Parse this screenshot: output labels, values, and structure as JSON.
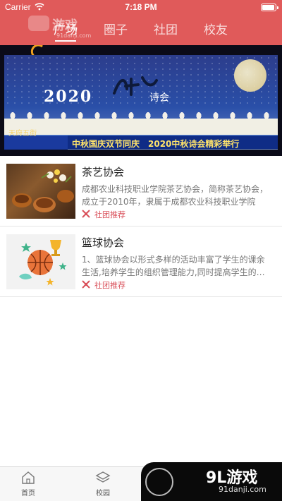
{
  "status_bar": {
    "carrier": "Carrier",
    "time": "7:18 PM",
    "battery_level": 1.0
  },
  "tabs": [
    {
      "label": "广场",
      "active": true
    },
    {
      "label": "圈子",
      "active": false
    },
    {
      "label": "社团",
      "active": false
    },
    {
      "label": "校友",
      "active": false
    }
  ],
  "banner": {
    "year": "2020",
    "poem": "诗会",
    "channel": "天府五街",
    "ticker": "中秋国庆双节同庆　2020中秋诗会精彩举行"
  },
  "clubs": [
    {
      "title": "茶艺协会",
      "description": "成都农业科技职业学院茶艺协会，简称茶艺协会，成立于2010年，隶属于成都农业科技职业学院",
      "tag": "社团推荐",
      "thumb_icon": "tea-set-image"
    },
    {
      "title": "篮球协会",
      "description": "1、篮球协会以形式多样的活动丰富了学生的课余生活,培养学生的组织管理能力,同时提高学生的身体素质",
      "tag": "社团推荐",
      "thumb_icon": "basketball-trophy-image"
    }
  ],
  "tabbar": [
    {
      "label": "首页",
      "icon": "home-icon"
    },
    {
      "label": "校园",
      "icon": "layers-icon"
    }
  ],
  "watermark": {
    "main": "9L游戏",
    "url": "91danji.com",
    "top_text": "游戏",
    "top_url": "91danji.com"
  },
  "colors": {
    "header": "#e05a5a",
    "tag": "#d9505a",
    "ticker_text": "#ffe36a"
  }
}
